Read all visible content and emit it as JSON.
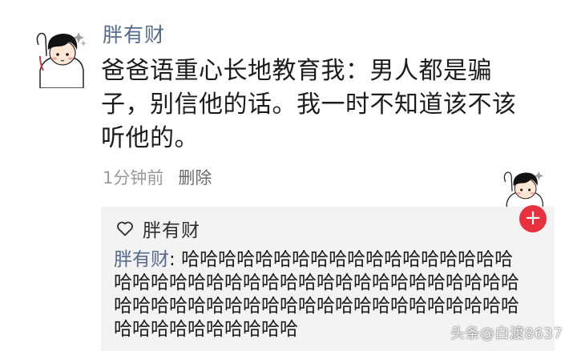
{
  "comment": {
    "username": "胖有财",
    "text": "爸爸语重心长地教育我：男人都是骗子，别信他的话。我一时不知道该不该听他的。",
    "time": "1分钟前",
    "delete_label": "删除"
  },
  "reply": {
    "liked_by": "胖有财",
    "author": "胖有财",
    "separator": ": ",
    "text": "哈哈哈哈哈哈哈哈哈哈哈哈哈哈哈哈哈哈哈哈哈哈哈哈哈哈哈哈哈哈哈哈哈哈哈哈哈哈哈哈哈哈哈哈哈哈哈哈哈哈哈哈哈哈哈哈哈哈哈哈哈哈哈哈哈哈哈哈哈哈哈哈"
  },
  "floating_button": {
    "label": "+"
  },
  "watermark": {
    "text": "头条@白渡8637"
  },
  "colors": {
    "username": "#566a8c",
    "accent_red": "#e8303f",
    "reply_bg": "#f3f3f3"
  },
  "icons": {
    "avatar": "cartoon-boy-avatar",
    "like": "heart-outline-icon",
    "add": "plus-icon"
  }
}
